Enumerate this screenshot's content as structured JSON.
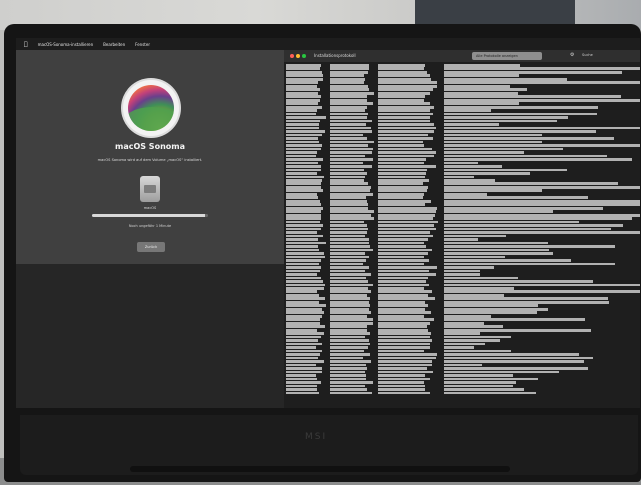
{
  "menubar": {
    "apple_icon": "apple-icon",
    "app_name": "macOS-Sonoma-installieren",
    "menus": [
      "Bearbeiten",
      "Fenster"
    ]
  },
  "installer": {
    "logo_icon": "macos-sonoma-logo",
    "title": "macOS Sonoma",
    "subtitle": "macOS Sonoma wird auf dem Volume „macOS“ installiert.",
    "disk_icon": "hard-disk-icon",
    "disk_label": "macOS",
    "progress": 0.97,
    "status": "Noch ungefähr 1 Minute",
    "button_label": "Zurück"
  },
  "terminal": {
    "title": "Installationsprotokoll",
    "search_value": "Alle Protokolle anzeigen",
    "gear_icon": "gear-icon",
    "filter_label": "Suche"
  },
  "hardware": {
    "brand": "MSI"
  },
  "colors": {
    "screen_bg": "#2b2b2b",
    "installer_bg": "#404040",
    "terminal_bg": "#1e1e1e",
    "close": "#ff5f57",
    "minimize": "#febc2e",
    "zoom": "#28c840"
  }
}
